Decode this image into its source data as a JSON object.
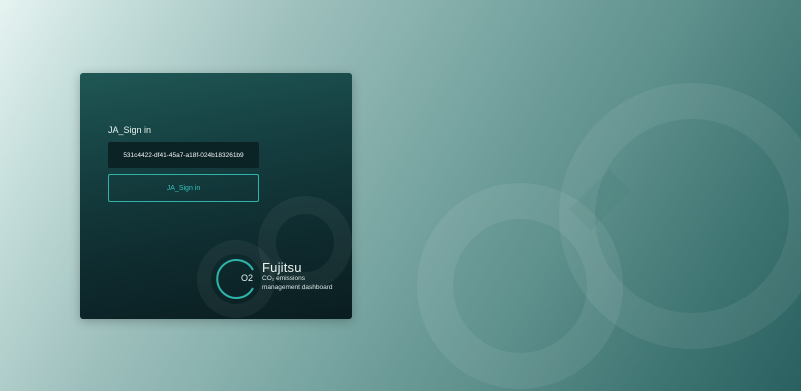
{
  "signin": {
    "heading": "JA_Sign in",
    "id_value": "531c4422-df41-45a7-a18f-024b183261b9",
    "button_label": "JA_Sign in"
  },
  "brand": {
    "o2_label": "O2",
    "name": "Fujitsu",
    "subtitle_line1": "CO₂ emissions",
    "subtitle_line2": "management dashboard"
  },
  "colors": {
    "accent": "#2fb3ab",
    "card_dark": "#0e2a2d"
  },
  "icons": {
    "background_logo": "infinity-icon",
    "brand_logo": "ring-logo-icon"
  }
}
